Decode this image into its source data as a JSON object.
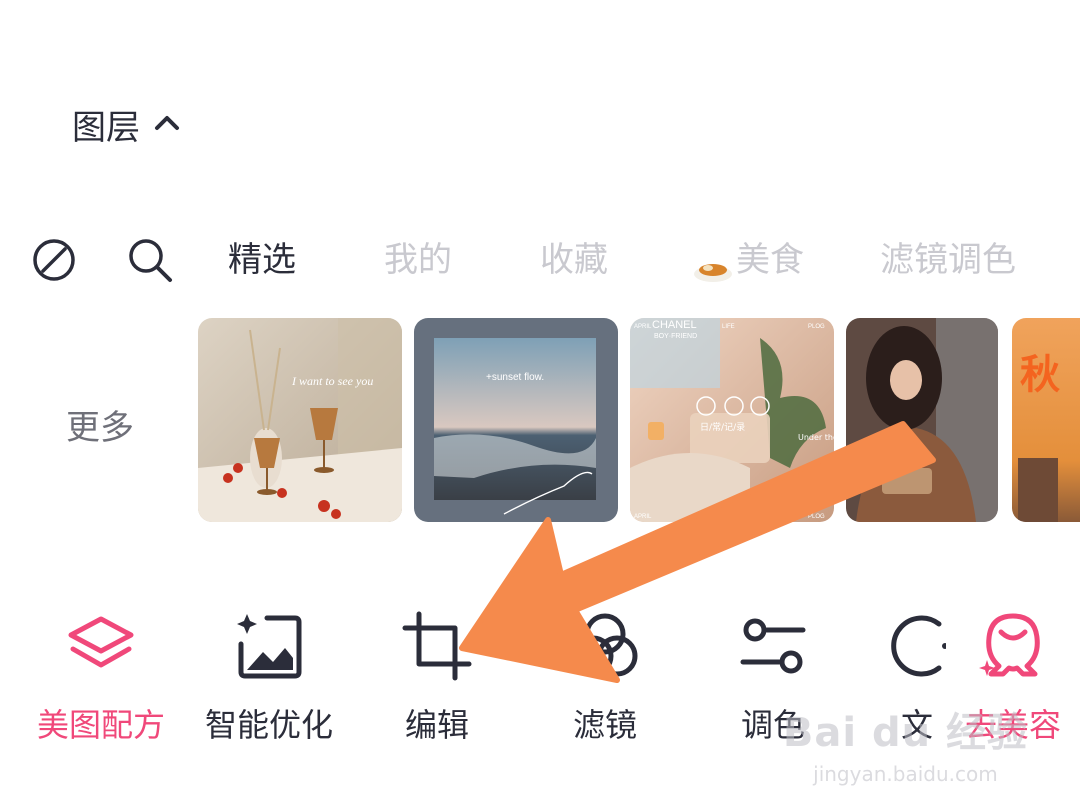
{
  "layer_section": {
    "label": "图层",
    "chevron_icon": "chevron-up-icon"
  },
  "filter_bar": {
    "clear_icon": "no-filter-icon",
    "search_icon": "search-icon",
    "tabs": [
      {
        "label": "精选",
        "active": true
      },
      {
        "label": "我的",
        "active": false
      },
      {
        "label": "收藏",
        "active": false
      },
      {
        "label": "美食",
        "active": false,
        "icon": "food-bowl-icon"
      },
      {
        "label": "滤镜调色",
        "active": false
      }
    ]
  },
  "more": {
    "label": "更多"
  },
  "thumbnails": [
    {
      "caption": "I want to see you"
    },
    {
      "caption": "+sunset flow."
    },
    {
      "caption_top": "CHANEL",
      "caption_sub": "BOY·FRIEND",
      "corner_tl": "APRIL",
      "corner_tm": "LIFE",
      "corner_tr": "PLOG",
      "center_text": "日/常/记/录",
      "side_text": "Under the tree 在树下",
      "corner_bl": "APRIL",
      "corner_br": "PLOG"
    },
    {},
    {
      "caption": "秋"
    }
  ],
  "toolbar": [
    {
      "label": "美图配方",
      "icon": "layers-icon",
      "accent": true
    },
    {
      "label": "智能优化",
      "icon": "magic-photo-icon",
      "accent": false
    },
    {
      "label": "编辑",
      "icon": "crop-icon",
      "accent": false
    },
    {
      "label": "滤镜",
      "icon": "filter-circles-icon",
      "accent": false
    },
    {
      "label": "调色",
      "icon": "adjust-sliders-icon",
      "accent": false
    },
    {
      "label": "文",
      "icon": "text-icon",
      "accent": false
    },
    {
      "label": "去美容",
      "icon": "beauty-face-icon",
      "accent": true
    }
  ],
  "watermark": {
    "brand": "Bai du 经验",
    "url": "jingyan.baidu.com"
  },
  "colors": {
    "accent": "#f0487a",
    "text": "#2b2d3a",
    "inactive_tab": "#c9c9cf",
    "arrow": "#f58a4c"
  }
}
